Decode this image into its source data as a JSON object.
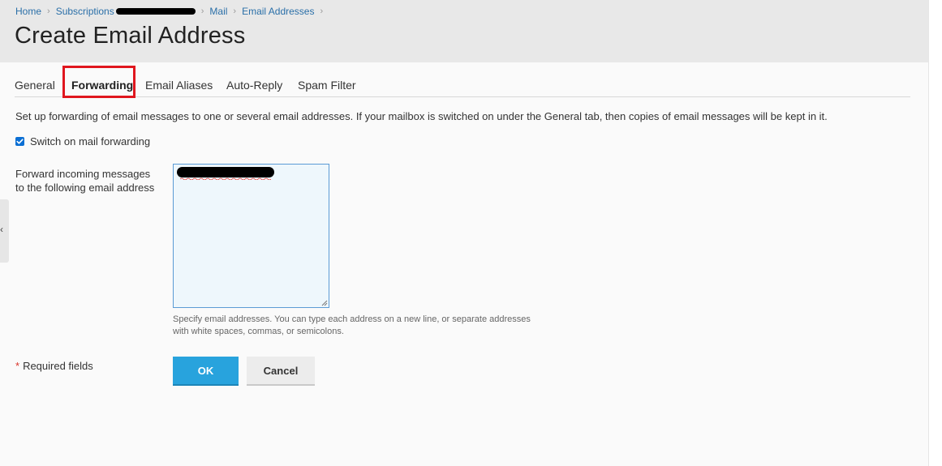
{
  "breadcrumb": {
    "home": "Home",
    "subscriptions": "Subscriptions",
    "mail": "Mail",
    "email_addresses": "Email Addresses",
    "separator": "›"
  },
  "page_title": "Create Email Address",
  "tabs": [
    {
      "label": "General",
      "active": false
    },
    {
      "label": "Forwarding",
      "active": true
    },
    {
      "label": "Email Aliases",
      "active": false
    },
    {
      "label": "Auto-Reply",
      "active": false
    },
    {
      "label": "Spam Filter",
      "active": false
    }
  ],
  "description": "Set up forwarding of email messages to one or several email addresses. If your mailbox is switched on under the General tab, then copies of email messages will be kept in it.",
  "forwarding_toggle": {
    "label": "Switch on mail forwarding",
    "checked": true
  },
  "forward_field": {
    "label": "Forward incoming messages to the following email address",
    "hint": "Specify email addresses. You can type each address on a new line, or separate addresses with white spaces, commas, or semicolons."
  },
  "required": {
    "star": "*",
    "label": "Required fields"
  },
  "buttons": {
    "ok": "OK",
    "cancel": "Cancel"
  },
  "side_handle": "‹",
  "colors": {
    "accent": "#28a3dd",
    "link": "#2a6fa8",
    "highlight": "#e0161e",
    "checkbox": "#0b6fd4",
    "required_star": "#d9332a"
  }
}
